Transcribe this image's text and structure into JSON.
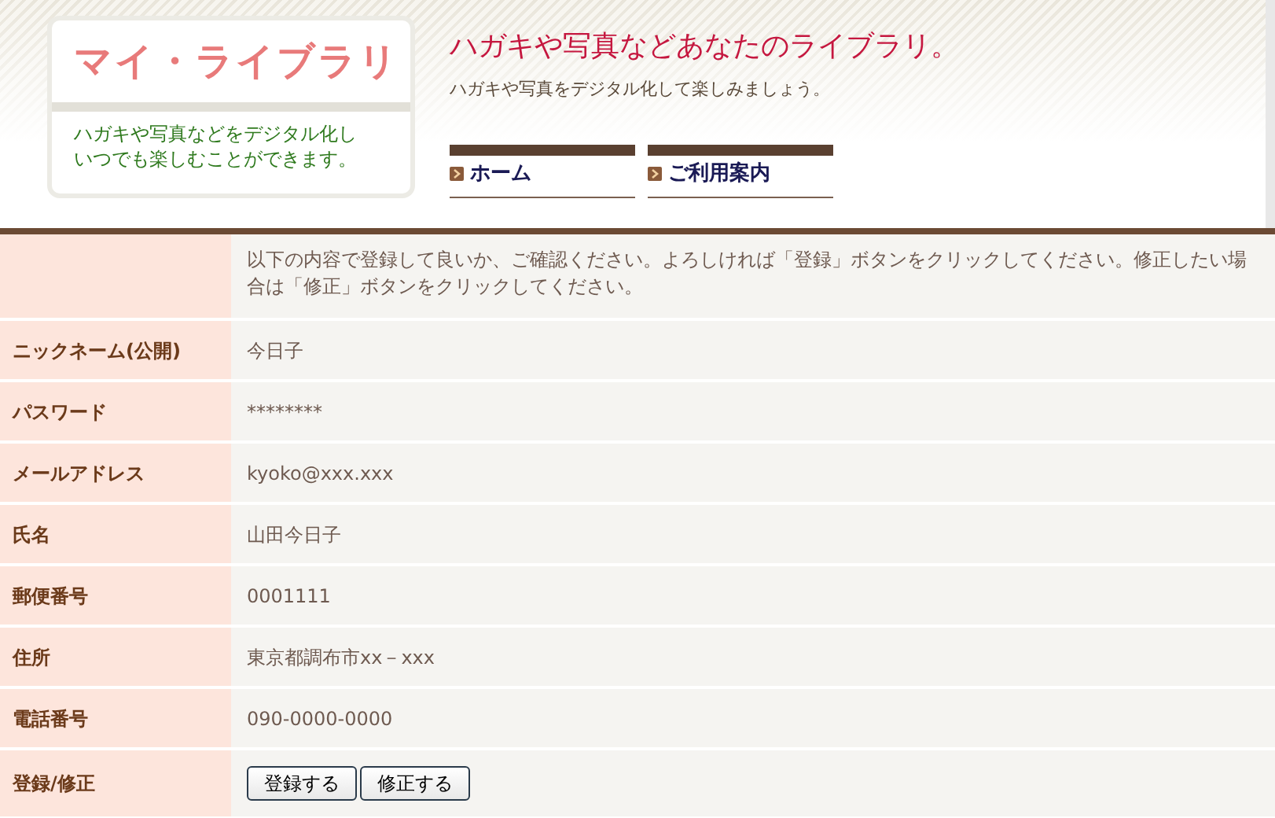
{
  "header": {
    "logo_title": "マイ・ライブラリ",
    "logo_caption": [
      "ハガキや写真などをデジタル化し",
      "いつでも楽しむことができます。"
    ],
    "headline": "ハガキや写真などあなたのライブラリ。",
    "subline": "ハガキや写真をデジタル化して楽しみましょう。",
    "nav": [
      {
        "label": "ホーム"
      },
      {
        "label": "ご利用案内"
      }
    ]
  },
  "form": {
    "intro": "以下の内容で登録して良いか、ご確認ください。よろしければ「登録」ボタンをクリックしてください。修正したい場合は「修正」ボタンをクリックしてください。",
    "rows": [
      {
        "kind": "text",
        "label": "ニックネーム(公開)",
        "value": "今日子"
      },
      {
        "kind": "text",
        "label": "パスワード",
        "value": "********"
      },
      {
        "kind": "text",
        "label": "メールアドレス",
        "value": "kyoko@xxx.xxx"
      },
      {
        "kind": "text",
        "label": "氏名",
        "value": "山田今日子"
      },
      {
        "kind": "text",
        "label": "郵便番号",
        "value": "0001111"
      },
      {
        "kind": "text",
        "label": "住所",
        "value": "東京都調布市xx－xxx"
      },
      {
        "kind": "text",
        "label": "電話番号",
        "value": "090-0000-0000"
      },
      {
        "kind": "buttons",
        "label": "登録/修正",
        "buttons": [
          "登録する",
          "修正する"
        ]
      }
    ]
  }
}
